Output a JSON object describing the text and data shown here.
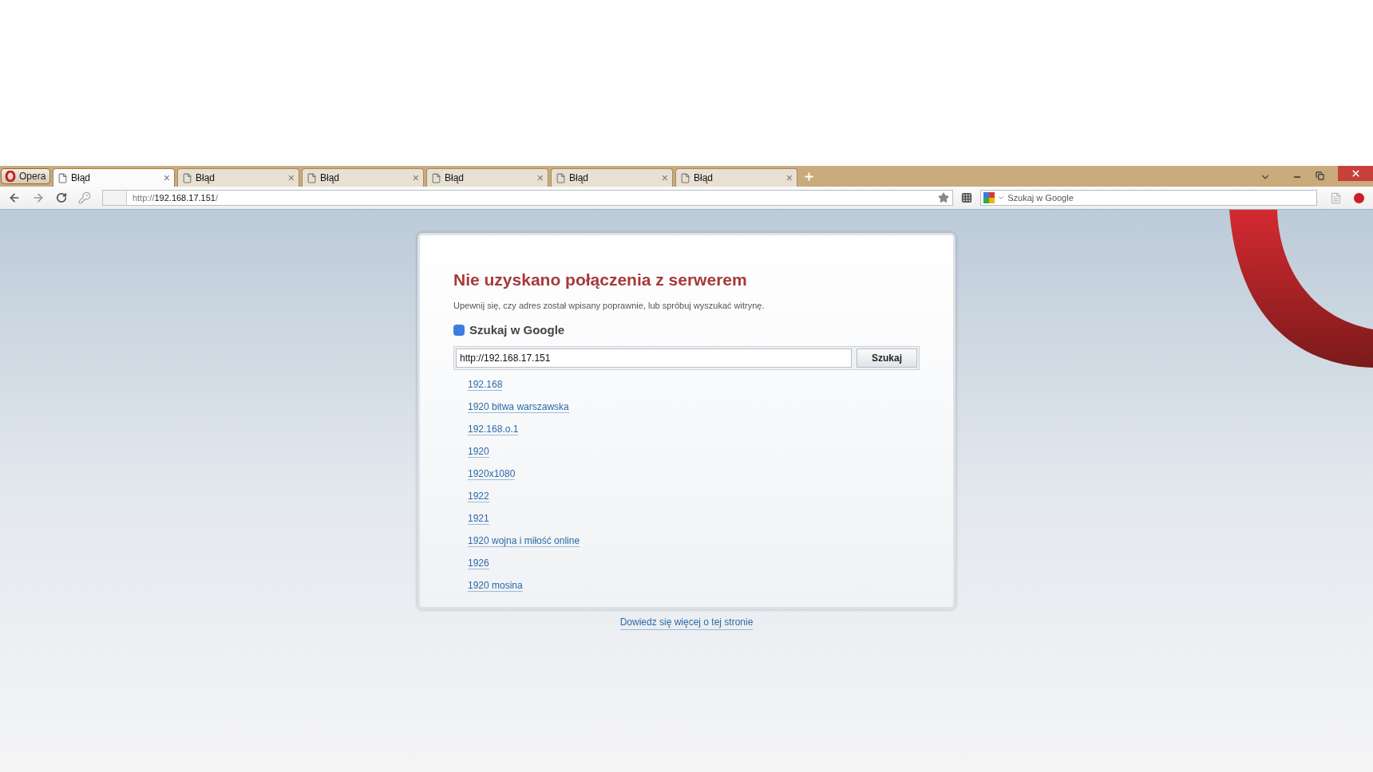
{
  "menu_button": {
    "label": "Opera"
  },
  "tabs": [
    {
      "title": "Błąd",
      "close": "×",
      "selected": true
    },
    {
      "title": "Błąd",
      "close": "×",
      "selected": false
    },
    {
      "title": "Błąd",
      "close": "×",
      "selected": false
    },
    {
      "title": "Błąd",
      "close": "×",
      "selected": false
    },
    {
      "title": "Błąd",
      "close": "×",
      "selected": false
    },
    {
      "title": "Błąd",
      "close": "×",
      "selected": false
    }
  ],
  "address_bar": {
    "prefix": "http://",
    "host": "192.168.17.151",
    "suffix": "/"
  },
  "search_bar": {
    "placeholder": "Szukaj w Google"
  },
  "error_page": {
    "title": "Nie uzyskano połączenia z serwerem",
    "message": "Upewnij się, czy adres został wpisany poprawnie, lub spróbuj wyszukać witrynę.",
    "search_heading": "Szukaj w Google",
    "search_value": "http://192.168.17.151",
    "search_button": "Szukaj",
    "suggestions": [
      "192.168",
      "1920 bitwa warszawska",
      "192.168.o.1",
      "1920",
      "1920x1080",
      "1922",
      "1921",
      "1920 wojna i miłość online",
      "1926",
      "1920 mosina"
    ],
    "footer_link": "Dowiedz się więcej o tej stronie"
  }
}
